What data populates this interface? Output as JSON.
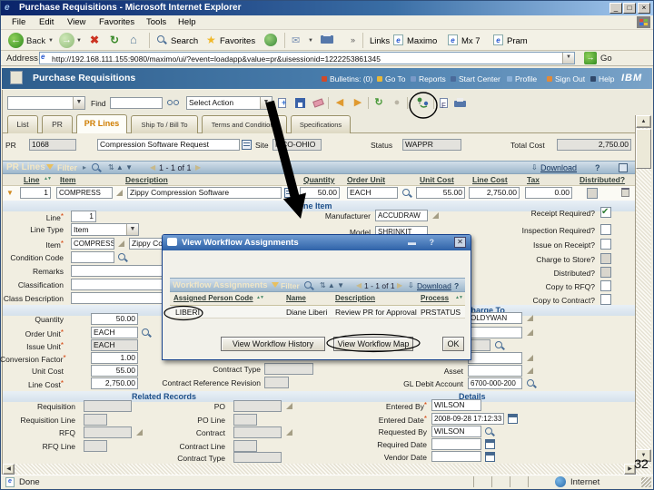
{
  "browser": {
    "title": "Purchase Requisitions - Microsoft Internet Explorer",
    "menu": [
      "File",
      "Edit",
      "View",
      "Favorites",
      "Tools",
      "Help"
    ],
    "toolbar": {
      "back": "Back",
      "search": "Search",
      "favorites": "Favorites"
    },
    "links_label": "Links",
    "links": [
      "Maximo",
      "Mx 7",
      "Pram"
    ],
    "address_label": "Address",
    "url": "http://192.168.111.155:9080/maximo/ui/?event=loadapp&value=pr&uisessionid=1222253861345",
    "go_label": "Go",
    "status_left": "Done",
    "status_zone": "Internet"
  },
  "app": {
    "title": "Purchase Requisitions",
    "nav": {
      "bulletins": "Bulletins: (0)",
      "goto": "Go To",
      "reports": "Reports",
      "start_center": "Start Center",
      "profile": "Profile",
      "sign_out": "Sign Out",
      "help": "Help",
      "brand": "IBM"
    },
    "find_label": "Find",
    "select_action": "Select Action",
    "tabs": [
      "List",
      "PR",
      "PR Lines",
      "Ship To / Bill To",
      "Terms and Conditions",
      "Specifications"
    ],
    "record": {
      "pr_label": "PR",
      "pr": "1068",
      "description": "Compression Software Request",
      "site_label": "Site",
      "site": "MCO-OHIO",
      "status_label": "Status",
      "status": "WAPPR",
      "total_label": "Total Cost",
      "total": "2,750.00"
    }
  },
  "pr_lines_table": {
    "title": "PR Lines",
    "filter": "Filter",
    "pager": "1 - 1 of 1",
    "download": "Download",
    "columns": {
      "line": "Line",
      "item": "Item",
      "description": "Description",
      "quantity": "Quantity",
      "order_unit": "Order Unit",
      "unit_cost": "Unit Cost",
      "line_cost": "Line Cost",
      "tax": "Tax",
      "distributed": "Distributed?"
    },
    "row": {
      "line": "1",
      "item": "COMPRESS",
      "description": "Zippy Compression Software",
      "quantity": "50.00",
      "order_unit": "EACH",
      "unit_cost": "55.00",
      "line_cost": "2,750.00",
      "tax": "0.00"
    }
  },
  "line_item": {
    "section_title": "Line Item",
    "line": {
      "label": "Line",
      "value": "1"
    },
    "line_type": {
      "label": "Line Type",
      "value": "Item"
    },
    "item": {
      "label": "Item",
      "value": "COMPRESS",
      "description": "Zippy Compression Software"
    },
    "condition_code": {
      "label": "Condition Code",
      "value": ""
    },
    "remarks": {
      "label": "Remarks",
      "value": ""
    },
    "classification": {
      "label": "Classification",
      "value": ""
    },
    "class_description": {
      "label": "Class Description",
      "value": ""
    },
    "manufacturer": {
      "label": "Manufacturer",
      "value": "ACCUDRAW"
    },
    "model": {
      "label": "Model",
      "value": "SHRINKIT"
    },
    "checks": [
      {
        "label": "Receipt Required?",
        "checked": true
      },
      {
        "label": "Inspection Required?",
        "checked": false
      },
      {
        "label": "Issue on Receipt?",
        "checked": false
      },
      {
        "label": "Charge to Store?",
        "checked": false
      },
      {
        "label": "Distributed?",
        "checked": false
      },
      {
        "label": "Copy to RFQ?",
        "checked": false
      },
      {
        "label": "Copy to Contract?",
        "checked": false
      }
    ]
  },
  "quantity_section": {
    "title": "Quantity",
    "quantity": {
      "label": "Quantity",
      "value": "50.00"
    },
    "order_unit": {
      "label": "Order Unit",
      "value": "EACH"
    },
    "issue_unit": {
      "label": "Issue Unit",
      "value": "EACH"
    },
    "conversion_factor": {
      "label": "Conversion Factor",
      "value": "1.00"
    },
    "unit_cost": {
      "label": "Unit Cost",
      "value": "55.00"
    },
    "line_cost": {
      "label": "Line Cost",
      "value": "2,750.00"
    },
    "contract_type": {
      "label": "Contract Type",
      "value": ""
    },
    "contract_reference_revision": {
      "label": "Contract Reference Revision",
      "value": ""
    }
  },
  "charge_to": {
    "title": "Charge To",
    "row1_value": "OLDYWAN",
    "asset": {
      "label": "Asset",
      "value": ""
    },
    "gl_debit_account": {
      "label": "GL Debit Account",
      "value": "6700-000-200"
    }
  },
  "related_records": {
    "title": "Related Records",
    "requisition": {
      "label": "Requisition"
    },
    "requisition_line": {
      "label": "Requisition Line"
    },
    "rfq": {
      "label": "RFQ"
    },
    "rfq_line": {
      "label": "RFQ Line"
    },
    "po": {
      "label": "PO"
    },
    "po_line": {
      "label": "PO Line"
    },
    "contract": {
      "label": "Contract"
    },
    "contract_line": {
      "label": "Contract Line"
    },
    "contract_type": {
      "label": "Contract Type"
    }
  },
  "details": {
    "title": "Details",
    "entered_by": {
      "label": "Entered By",
      "value": "WILSON"
    },
    "entered_date": {
      "label": "Entered Date",
      "value": "2008-09-28 17:12:33"
    },
    "requested_by": {
      "label": "Requested By",
      "value": "WILSON"
    },
    "required_date": {
      "label": "Required Date",
      "value": ""
    },
    "vendor_date": {
      "label": "Vendor Date",
      "value": ""
    }
  },
  "dialog": {
    "title": "View Workflow Assignments",
    "table_title": "Workflow Assignments",
    "filter": "Filter",
    "pager": "1 - 1 of 1",
    "download": "Download",
    "columns": {
      "code": "Assigned Person Code",
      "name": "Name",
      "description": "Description",
      "process": "Process"
    },
    "row": {
      "code": "LIBERI",
      "name": "Diane Liberi",
      "description": "Review PR for Approval",
      "process": "PRSTATUS"
    },
    "buttons": {
      "history": "View Workflow History",
      "map": "View Workflow Map",
      "ok": "OK"
    }
  },
  "annotation": {
    "slide_number": "32"
  }
}
